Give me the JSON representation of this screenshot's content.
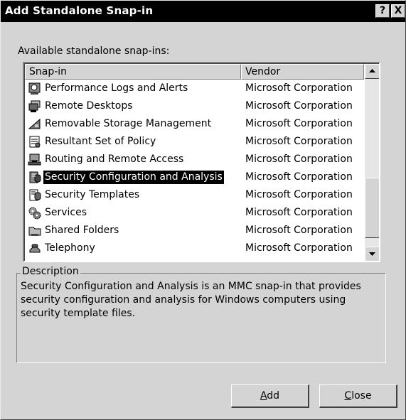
{
  "window": {
    "title": "Add Standalone Snap-in",
    "help_button": "?",
    "close_button": "X"
  },
  "available_label": "Available standalone snap-ins:",
  "list": {
    "columns": [
      "Snap-in",
      "Vendor"
    ],
    "rows": [
      {
        "name": "Performance Logs and Alerts",
        "vendor": "Microsoft Corporation",
        "icon": "performance-logs-icon",
        "selected": false
      },
      {
        "name": "Remote Desktops",
        "vendor": "Microsoft Corporation",
        "icon": "remote-desktops-icon",
        "selected": false
      },
      {
        "name": "Removable Storage Management",
        "vendor": "Microsoft Corporation",
        "icon": "removable-storage-icon",
        "selected": false
      },
      {
        "name": "Resultant Set of Policy",
        "vendor": "Microsoft Corporation",
        "icon": "resultant-set-of-policy-icon",
        "selected": false
      },
      {
        "name": "Routing and Remote Access",
        "vendor": "Microsoft Corporation",
        "icon": "routing-remote-access-icon",
        "selected": false
      },
      {
        "name": "Security Configuration and Analysis",
        "vendor": "Microsoft Corporation",
        "icon": "security-configuration-icon",
        "selected": true
      },
      {
        "name": "Security Templates",
        "vendor": "Microsoft Corporation",
        "icon": "security-templates-icon",
        "selected": false
      },
      {
        "name": "Services",
        "vendor": "Microsoft Corporation",
        "icon": "services-gear-icon",
        "selected": false
      },
      {
        "name": "Shared Folders",
        "vendor": "Microsoft Corporation",
        "icon": "shared-folders-icon",
        "selected": false
      },
      {
        "name": "Telephony",
        "vendor": "Microsoft Corporation",
        "icon": "telephony-icon",
        "selected": false
      }
    ]
  },
  "description": {
    "legend": "Description",
    "text": "Security Configuration and Analysis is an MMC snap-in that provides security configuration and analysis for Windows computers using security template files."
  },
  "buttons": {
    "add": {
      "mnemonic": "A",
      "rest": "dd"
    },
    "close": {
      "mnemonic": "C",
      "rest": "lose"
    }
  }
}
